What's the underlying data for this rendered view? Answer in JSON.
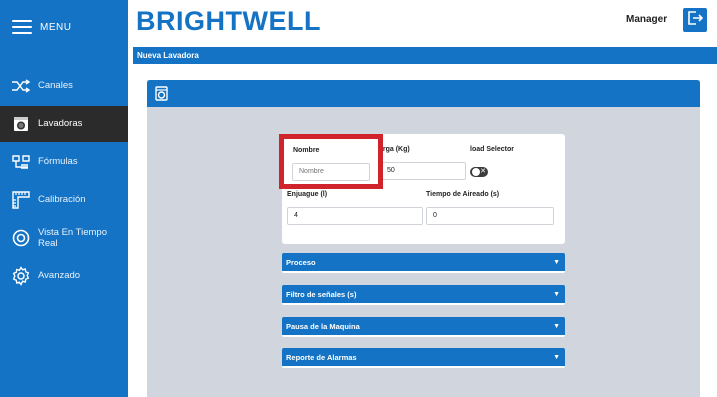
{
  "header": {
    "brand": "BRIGHTWELL",
    "user": "Manager",
    "logout_icon": "logout-icon"
  },
  "sidebar": {
    "menu_label": "MENU",
    "items": [
      {
        "label": "Canales",
        "icon": "shuffle-icon",
        "active": false
      },
      {
        "label": "Lavadoras",
        "icon": "washer-icon",
        "active": true
      },
      {
        "label": "Fórmulas",
        "icon": "formula-icon",
        "active": false
      },
      {
        "label": "Calibración",
        "icon": "ruler-icon",
        "active": false
      },
      {
        "label": "Vista En Tiempo Real",
        "icon": "eye-icon",
        "active": false
      },
      {
        "label": "Avanzado",
        "icon": "gear-icon",
        "active": false
      }
    ]
  },
  "page": {
    "title": "Nueva Lavadora"
  },
  "form": {
    "nombre_label": "Nombre",
    "nombre_placeholder": "Nombre",
    "carga_label": "arga (Kg)",
    "carga_value": "50",
    "load_selector_label": "load Selector",
    "load_selector_on": false,
    "enjuague_label": "Enjuague (l)",
    "enjuague_value": "4",
    "aireado_label": "Tiempo de Aireado (s)",
    "aireado_value": "0"
  },
  "sections": [
    {
      "label": "Proceso"
    },
    {
      "label": "Filtro de señales (s)"
    },
    {
      "label": "Pausa de la Maquina"
    },
    {
      "label": "Reporte de Alarmas"
    }
  ],
  "colors": {
    "primary": "#1473c4",
    "highlight": "#d0232b",
    "content_bg": "#d1d6de"
  }
}
